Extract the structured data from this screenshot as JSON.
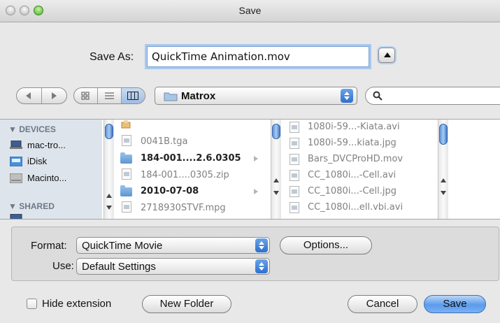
{
  "window": {
    "title": "Save"
  },
  "save_as": {
    "label": "Save As:",
    "value": "QuickTime Animation.mov"
  },
  "toolbar": {
    "current_folder": "Matrox",
    "search_placeholder": ""
  },
  "sidebar": {
    "devices_header": "▼ DEVICES",
    "devices": [
      {
        "label": "mac-tro...",
        "icon": "laptop-icon"
      },
      {
        "label": "iDisk",
        "icon": "idisk-icon"
      },
      {
        "label": "Macinto...",
        "icon": "hard-disk-icon"
      }
    ],
    "shared_header": "▼ SHARED"
  },
  "column1": {
    "items": [
      {
        "name": "",
        "kind": "package",
        "enabled": false
      },
      {
        "name": "0041B.tga",
        "kind": "file",
        "enabled": false
      },
      {
        "name": "184-001....2.6.0305",
        "kind": "folder",
        "enabled": true
      },
      {
        "name": "184-001....0305.zip",
        "kind": "file",
        "enabled": false
      },
      {
        "name": "2010-07-08",
        "kind": "folder",
        "enabled": true
      },
      {
        "name": "2718930STVF.mpg",
        "kind": "file",
        "enabled": false
      }
    ]
  },
  "column2": {
    "items": [
      {
        "name": "1080i-59...-Kiata.avi"
      },
      {
        "name": "1080i-59...kiata.jpg"
      },
      {
        "name": "Bars_DVCProHD.mov"
      },
      {
        "name": "CC_1080i...-Cell.avi"
      },
      {
        "name": "CC_1080i...-Cell.jpg"
      },
      {
        "name": "CC_1080i...ell.vbi.avi"
      }
    ]
  },
  "format": {
    "label": "Format:",
    "value": "QuickTime Movie",
    "options_button": "Options..."
  },
  "use": {
    "label": "Use:",
    "value": "Default Settings"
  },
  "footer": {
    "hide_extension_label": "Hide extension",
    "hide_extension_checked": false,
    "new_folder_button": "New Folder",
    "cancel_button": "Cancel",
    "save_button": "Save"
  },
  "colors": {
    "accent": "#5b9bec",
    "sidebar_bg": "#dee4ec"
  }
}
